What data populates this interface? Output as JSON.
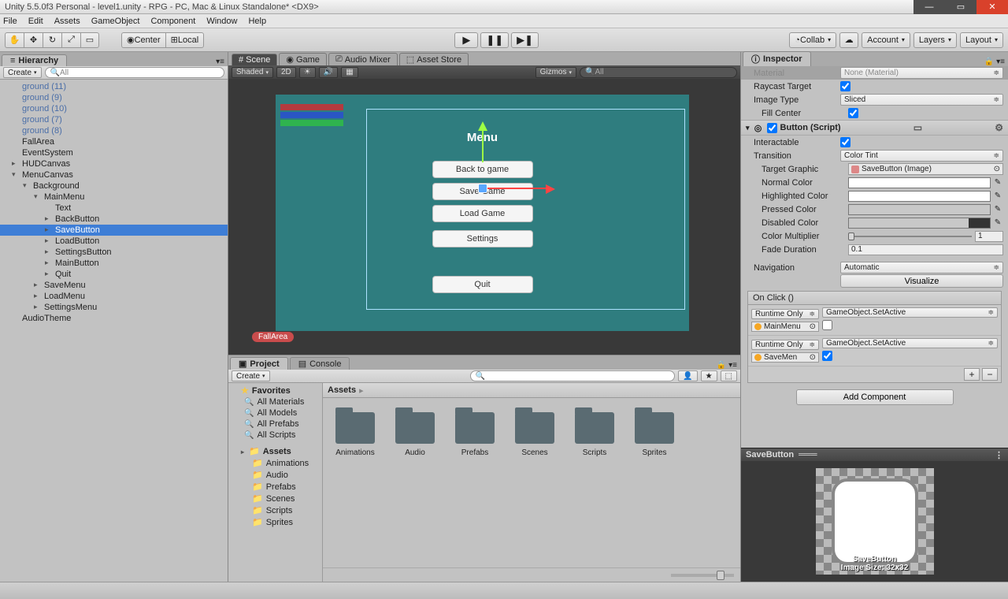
{
  "title": "Unity 5.5.0f3 Personal - level1.unity - RPG - PC, Mac & Linux Standalone* <DX9>",
  "menubar": [
    "File",
    "Edit",
    "Assets",
    "GameObject",
    "Component",
    "Window",
    "Help"
  ],
  "toolbar": {
    "pivot": "Center",
    "handle": "Local",
    "collab": "Collab",
    "account": "Account",
    "layers": "Layers",
    "layout": "Layout"
  },
  "hierarchy": {
    "tab": "Hierarchy",
    "create": "Create",
    "search_placeholder": "All",
    "items": [
      {
        "label": "ground (11)",
        "cls": "i1",
        "blue": true
      },
      {
        "label": "ground (9)",
        "cls": "i1",
        "blue": true
      },
      {
        "label": "ground (10)",
        "cls": "i1",
        "blue": true
      },
      {
        "label": "ground (7)",
        "cls": "i1",
        "blue": true
      },
      {
        "label": "ground (8)",
        "cls": "i1",
        "blue": true
      },
      {
        "label": "FallArea",
        "cls": "i1"
      },
      {
        "label": "EventSystem",
        "cls": "i1"
      },
      {
        "label": "HUDCanvas",
        "cls": "i1",
        "fold": true
      },
      {
        "label": "MenuCanvas",
        "cls": "i1",
        "fold": true,
        "open": true
      },
      {
        "label": "Background",
        "cls": "i2",
        "fold": true,
        "open": true
      },
      {
        "label": "MainMenu",
        "cls": "i3",
        "fold": true,
        "open": true
      },
      {
        "label": "Text",
        "cls": "i4"
      },
      {
        "label": "BackButton",
        "cls": "i4",
        "fold": true
      },
      {
        "label": "SaveButton",
        "cls": "i4",
        "fold": true,
        "sel": true
      },
      {
        "label": "LoadButton",
        "cls": "i4",
        "fold": true
      },
      {
        "label": "SettingsButton",
        "cls": "i4",
        "fold": true
      },
      {
        "label": "MainButton",
        "cls": "i4",
        "fold": true
      },
      {
        "label": "Quit",
        "cls": "i4",
        "fold": true
      },
      {
        "label": "SaveMenu",
        "cls": "i3",
        "fold": true
      },
      {
        "label": "LoadMenu",
        "cls": "i3",
        "fold": true
      },
      {
        "label": "SettingsMenu",
        "cls": "i3",
        "fold": true
      },
      {
        "label": "AudioTheme",
        "cls": "i1"
      }
    ]
  },
  "scene": {
    "tabs": [
      "Scene",
      "Game",
      "Audio Mixer",
      "Asset Store"
    ],
    "shaded": "Shaded",
    "mode2d": "2D",
    "gizmos": "Gizmos",
    "search_placeholder": "All",
    "menu_title": "Menu",
    "buttons": [
      "Back to game",
      "Save Game",
      "Load Game",
      "Settings",
      "Quit"
    ],
    "fallarea": "FallArea"
  },
  "project": {
    "tabs": [
      "Project",
      "Console"
    ],
    "create": "Create",
    "favorites": "Favorites",
    "fav_items": [
      "All Materials",
      "All Models",
      "All Prefabs",
      "All Scripts"
    ],
    "assets_label": "Assets",
    "assets_tree": [
      "Animations",
      "Audio",
      "Prefabs",
      "Scenes",
      "Scripts",
      "Sprites"
    ],
    "assets_crumb": "Assets",
    "folders": [
      "Animations",
      "Audio",
      "Prefabs",
      "Scenes",
      "Scripts",
      "Sprites"
    ]
  },
  "inspector": {
    "tab": "Inspector",
    "material_value": "None (Material)",
    "raycast": "Raycast Target",
    "image_type": "Image Type",
    "image_type_value": "Sliced",
    "fill_center": "Fill Center",
    "button_header": "Button (Script)",
    "interactable": "Interactable",
    "transition": "Transition",
    "transition_value": "Color Tint",
    "target_graphic": "Target Graphic",
    "target_graphic_value": "SaveButton (Image)",
    "normal_color": "Normal Color",
    "highlighted_color": "Highlighted Color",
    "pressed_color": "Pressed Color",
    "disabled_color": "Disabled Color",
    "color_multiplier": "Color Multiplier",
    "color_multiplier_value": "1",
    "fade_duration": "Fade Duration",
    "fade_duration_value": "0.1",
    "navigation": "Navigation",
    "navigation_value": "Automatic",
    "visualize": "Visualize",
    "onclick_header": "On Click ()",
    "runtime_only": "Runtime Only",
    "setactive": "GameObject.SetActive",
    "mainmenu_ref": "MainMenu",
    "savemenu_ref": "SaveMen",
    "add_component": "Add Component",
    "preview_title": "SaveButton",
    "preview_label1": "SaveButton",
    "preview_label2": "Image Size: 32x32"
  }
}
